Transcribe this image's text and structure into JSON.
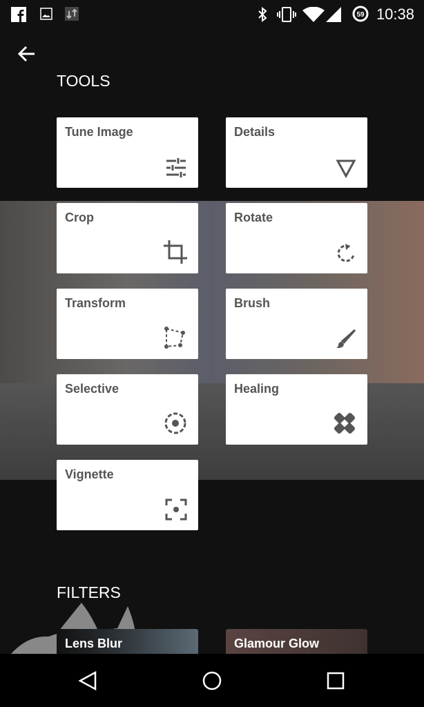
{
  "status_bar": {
    "time": "10:38",
    "battery": "59",
    "icons": [
      "facebook-icon",
      "image-icon",
      "data-transfer-icon",
      "bluetooth-icon",
      "vibrate-icon",
      "wifi-icon",
      "signal-icon",
      "battery-icon"
    ]
  },
  "header": {
    "back_icon": "arrow-left-icon"
  },
  "tools": {
    "title": "TOOLS",
    "items": [
      {
        "label": "Tune Image",
        "icon": "sliders-icon"
      },
      {
        "label": "Details",
        "icon": "triangle-down-icon"
      },
      {
        "label": "Crop",
        "icon": "crop-icon"
      },
      {
        "label": "Rotate",
        "icon": "rotate-icon"
      },
      {
        "label": "Transform",
        "icon": "perspective-icon"
      },
      {
        "label": "Brush",
        "icon": "brush-icon"
      },
      {
        "label": "Selective",
        "icon": "selective-icon"
      },
      {
        "label": "Healing",
        "icon": "bandage-icon"
      },
      {
        "label": "Vignette",
        "icon": "vignette-icon"
      }
    ]
  },
  "filters": {
    "title": "FILTERS",
    "items": [
      {
        "label": "Lens Blur"
      },
      {
        "label": "Glamour Glow"
      }
    ]
  },
  "nav": [
    "back-icon",
    "home-icon",
    "recents-icon"
  ]
}
